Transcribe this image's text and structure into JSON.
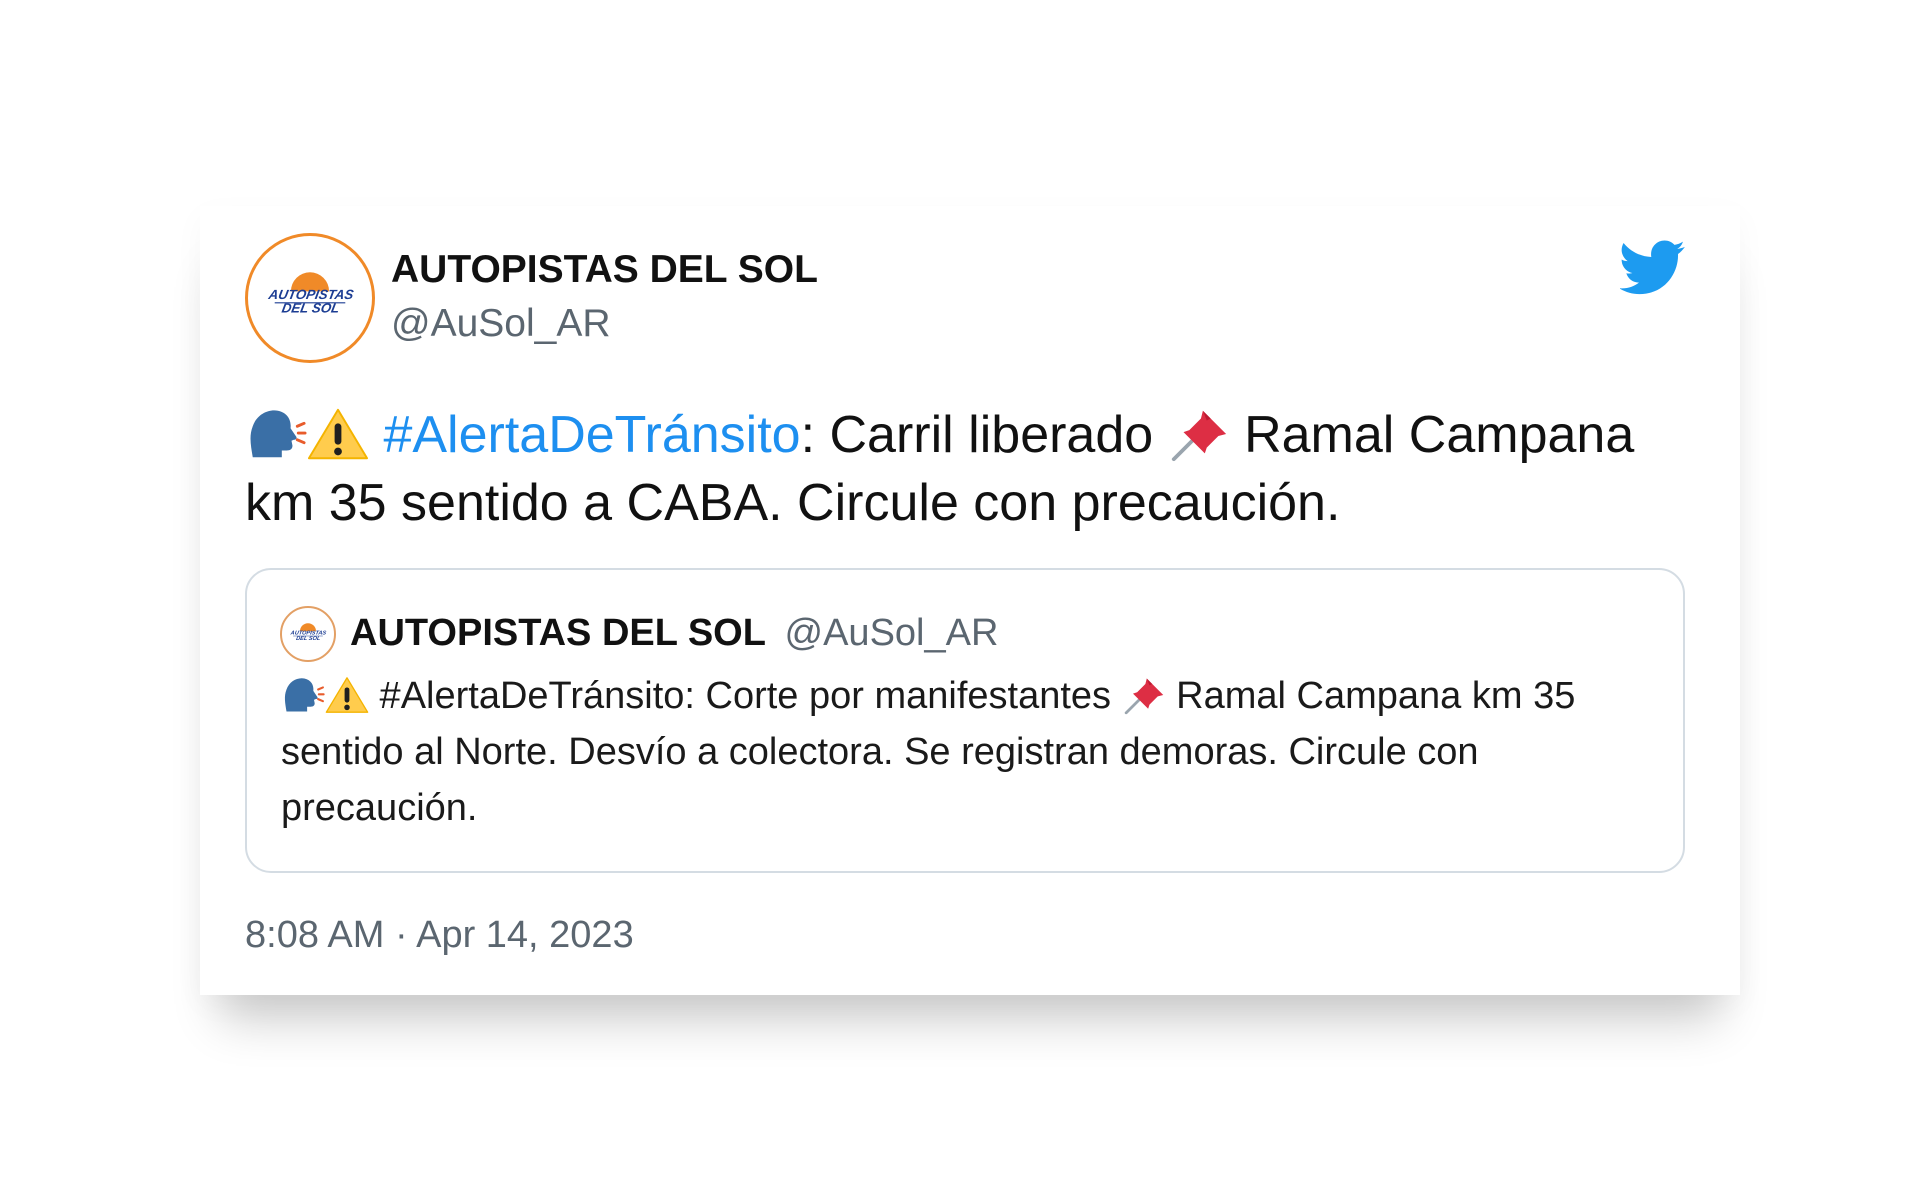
{
  "tweet": {
    "display_name": "AUTOPISTAS DEL SOL",
    "handle": "@AuSol_AR",
    "logo": {
      "line1": "AUTOPISTAS",
      "line2": "DEL SOL"
    },
    "text": {
      "hashtag": "#AlertaDeTránsito",
      "part1": ": Carril  liberado ",
      "part2": " Ramal Campana km 35 sentido a CABA. Circule con precaución."
    },
    "timestamp": "8:08 AM · Apr 14, 2023"
  },
  "quoted_tweet": {
    "display_name": "AUTOPISTAS DEL SOL",
    "handle": "@AuSol_AR",
    "text": {
      "prefix": " #AlertaDeTránsito: Corte por manifestantes ",
      "rest": " Ramal Campana km 35 sentido al Norte. Desvío a colectora. Se registran demoras. Circule con precaución."
    }
  },
  "icons": [
    "twitter-bird-icon",
    "speaking-head-emoji",
    "warning-emoji",
    "pushpin-emoji"
  ],
  "colors": {
    "accent": "#1d8ff0",
    "logo_orange": "#f08a28",
    "logo_blue": "#1c3d93",
    "muted": "#5b6670"
  }
}
